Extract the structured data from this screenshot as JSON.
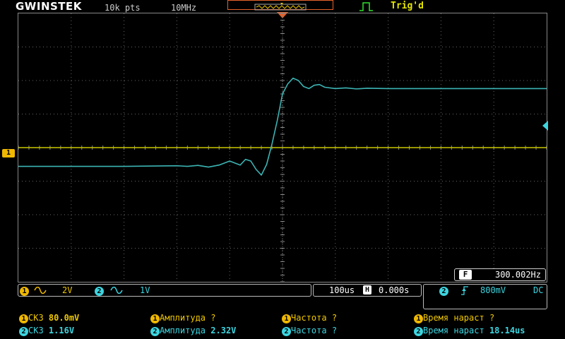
{
  "header": {
    "brand": "GWINSTEK",
    "record_length": "10k pts",
    "sample_rate": "10MHz",
    "trigger_status": "Trig'd"
  },
  "channels": {
    "ch1": {
      "number": "1",
      "coupling_icon": "ac-wave-icon",
      "scale": "2V",
      "color": "#f0b800"
    },
    "ch2": {
      "number": "2",
      "coupling_icon": "ac-wave-icon",
      "scale": "1V",
      "color": "#3cd5e0"
    }
  },
  "timebase": {
    "scale": "100us",
    "position_icon": "H",
    "position": "0.000s"
  },
  "trigger": {
    "source": "2",
    "slope_icon": "rising-edge-icon",
    "level": "800mV",
    "coupling": "DC"
  },
  "frequency_counter": {
    "badge": "F",
    "value": "300.002Hz"
  },
  "measurements": [
    {
      "channel": "1",
      "label": "СКЗ",
      "value": "80.0mV"
    },
    {
      "channel": "1",
      "label": "Амплитуда",
      "value": "?"
    },
    {
      "channel": "1",
      "label": "Частота",
      "value": "?"
    },
    {
      "channel": "1",
      "label": "Время нараст",
      "value": "?"
    },
    {
      "channel": "2",
      "label": "СКЗ",
      "value": "1.16V"
    },
    {
      "channel": "2",
      "label": "Амплитуда",
      "value": "2.32V"
    },
    {
      "channel": "2",
      "label": "Частота",
      "value": "?"
    },
    {
      "channel": "2",
      "label": "Время нараст",
      "value": "18.14us"
    }
  ],
  "chart_data": {
    "type": "line",
    "series": [
      {
        "channel": "1",
        "color": "#c8c800",
        "x": [
          -500,
          500
        ],
        "y": [
          0,
          0
        ]
      },
      {
        "channel": "2",
        "color": "#3cb4b4",
        "x": [
          -500,
          -300,
          -200,
          -180,
          -160,
          -140,
          -120,
          -100,
          -80,
          -70,
          -60,
          -50,
          -40,
          -30,
          -20,
          -10,
          0,
          10,
          20,
          30,
          40,
          50,
          60,
          70,
          80,
          100,
          120,
          140,
          160,
          200,
          300,
          500
        ],
        "y": [
          -1.16,
          -1.16,
          -1.14,
          -1.16,
          -1.13,
          -1.18,
          -1.12,
          -1.0,
          -1.12,
          -0.95,
          -1.0,
          -1.25,
          -1.42,
          -1.1,
          -0.5,
          0.2,
          1.0,
          1.3,
          1.47,
          1.4,
          1.22,
          1.16,
          1.26,
          1.28,
          1.2,
          1.16,
          1.18,
          1.15,
          1.17,
          1.16,
          1.16,
          1.16
        ]
      }
    ],
    "x_divisions": 10,
    "y_divisions": 8,
    "grid": true
  }
}
